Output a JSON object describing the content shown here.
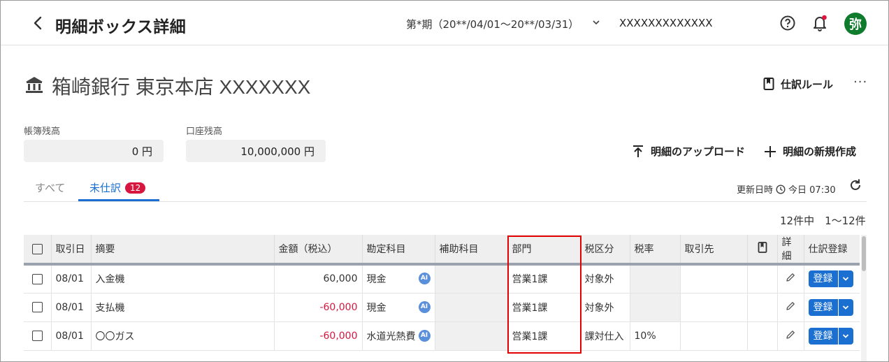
{
  "header": {
    "title": "明細ボックス詳細",
    "period": "第*期（20**/04/01〜20**/03/31）",
    "company": "XXXXXXXXXXXXX",
    "avatar": "弥"
  },
  "account": {
    "name": "箱崎銀行 東京本店 XXXXXXX",
    "rule_label": "仕訳ルール",
    "more_label": "···"
  },
  "balances": {
    "book_label": "帳簿残高",
    "book_value": "0 円",
    "account_label": "口座残高",
    "account_value": "10,000,000 円"
  },
  "actions": {
    "upload": "明細のアップロード",
    "create": "明細の新規作成"
  },
  "tabs": {
    "all": "すべて",
    "unjournaled": "未仕訳",
    "badge": "12"
  },
  "updated": {
    "label": "更新日時",
    "value": "今日 07:30"
  },
  "count": "12件中　1〜12件",
  "table": {
    "columns": [
      "取引日",
      "摘要",
      "金額（税込）",
      "勘定科目",
      "補助科目",
      "部門",
      "税区分",
      "税率",
      "取引先",
      "詳細",
      "仕訳登録"
    ],
    "rows": [
      {
        "date": "08/01",
        "desc": "入金機",
        "amount": "60,000",
        "negative": false,
        "account": "現金",
        "sub": "",
        "dept": "営業1課",
        "tax": "対象外",
        "rate": "",
        "partner": ""
      },
      {
        "date": "08/01",
        "desc": "支払機",
        "amount": "-60,000",
        "negative": true,
        "account": "現金",
        "sub": "",
        "dept": "営業1課",
        "tax": "対象外",
        "rate": "",
        "partner": ""
      },
      {
        "date": "08/01",
        "desc": "〇〇ガス",
        "amount": "-60,000",
        "negative": true,
        "account": "水道光熱費",
        "sub": "",
        "dept": "営業1課",
        "tax": "課対仕入",
        "rate": "10%",
        "partner": ""
      }
    ],
    "register_label": "登録",
    "ai_label": "AI"
  },
  "colors": {
    "primary": "#1a6fd1",
    "negative": "#d6163f",
    "avatar": "#0f7b2c",
    "highlight": "#e00000"
  }
}
